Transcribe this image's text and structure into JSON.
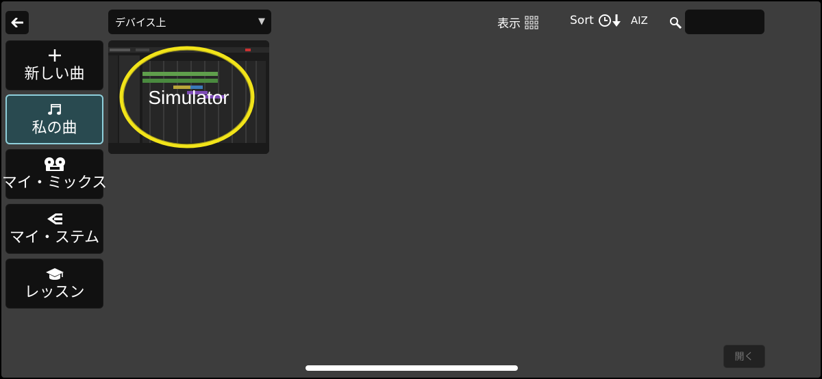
{
  "back": {
    "icon": "arrow-left-icon"
  },
  "sidebar": {
    "items": [
      {
        "label": "新しい曲",
        "icon": "plus-icon",
        "active": false
      },
      {
        "label": "私の曲",
        "icon": "music-note-icon",
        "active": true
      },
      {
        "label": "マイ・ミックス",
        "icon": "reel-icon",
        "active": false
      },
      {
        "label": "マイ・ステム",
        "icon": "stems-icon",
        "active": false
      },
      {
        "label": "レッスン",
        "icon": "graduation-cap-icon",
        "active": false
      }
    ]
  },
  "location": {
    "selected": "デバイス上",
    "icon": "triangle-down-icon"
  },
  "toolbar": {
    "view_label": "表示",
    "sort_label": "Sort",
    "az_label": "AIZ",
    "search_placeholder": ""
  },
  "song": {
    "title": "Simulator",
    "highlight_color": "#f2e419"
  },
  "open_button": {
    "label": "開く"
  },
  "colors": {
    "background": "#3d3d3d",
    "button": "#111111",
    "active_bg": "#294a50",
    "active_border": "#8fd0dc"
  }
}
